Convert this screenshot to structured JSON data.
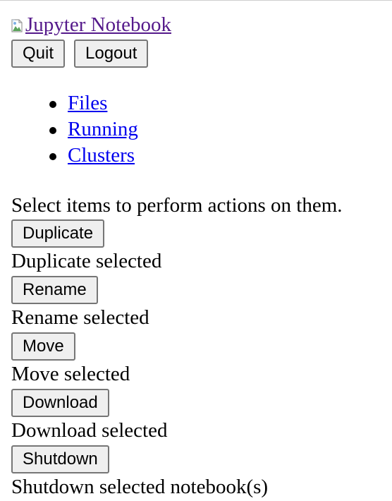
{
  "header": {
    "logo_text": "Jupyter Notebook",
    "logo_icon": "broken-image-icon",
    "quit_label": "Quit",
    "logout_label": "Logout"
  },
  "nav": {
    "items": [
      {
        "label": "Files"
      },
      {
        "label": "Running"
      },
      {
        "label": "Clusters"
      }
    ]
  },
  "actions": {
    "intro": "Select items to perform actions on them.",
    "items": [
      {
        "button": "Duplicate",
        "description": "Duplicate selected"
      },
      {
        "button": "Rename",
        "description": "Rename selected"
      },
      {
        "button": "Move",
        "description": "Move selected"
      },
      {
        "button": "Download",
        "description": "Download selected"
      },
      {
        "button": "Shutdown",
        "description": "Shutdown selected notebook(s)"
      }
    ]
  },
  "colors": {
    "visited_link": "#551a8b",
    "link": "#0000ee",
    "button_bg": "#efefef",
    "button_border": "#767676"
  }
}
